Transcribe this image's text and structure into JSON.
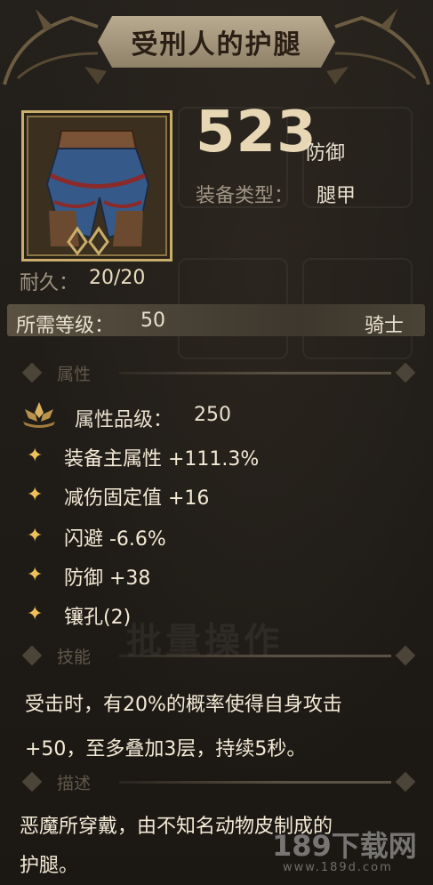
{
  "header": {
    "title": "受刑人的护腿"
  },
  "item": {
    "icon": "leg-armor-icon",
    "defense_value": "523",
    "defense_label": "防御",
    "type_label": "装备类型：",
    "type_value": "腿甲",
    "durability_label": "耐久：",
    "durability_value": "20/20",
    "level_label": "所需等级：",
    "level_value": "50",
    "class_value": "骑士"
  },
  "sections": {
    "attributes": "属性",
    "skill": "技能",
    "description": "描述"
  },
  "attributes": {
    "grade_label": "属性品级：",
    "grade_value": "250",
    "items": [
      "装备主属性 +111.3%",
      "减伤固定值 +16",
      "闪避 -6.6%",
      "防御 +38",
      "镶孔(2)"
    ]
  },
  "ghost_button": "批量操作",
  "skill": {
    "line1": "受击时，有20%的概率使得自身攻击",
    "line2": "+50，至多叠加3层，持续5秒。"
  },
  "description": {
    "line1": "恶魔所穿戴，由不知名动物皮制成的",
    "line2": "护腿。"
  },
  "watermark": {
    "main": "189下载网",
    "sub": "www.189d.com"
  },
  "colors": {
    "background": "#1d1a16",
    "title_plate": "#a89a7f",
    "accent_gold": "#f0c05a",
    "frame_gold": "#c9ad6a"
  }
}
